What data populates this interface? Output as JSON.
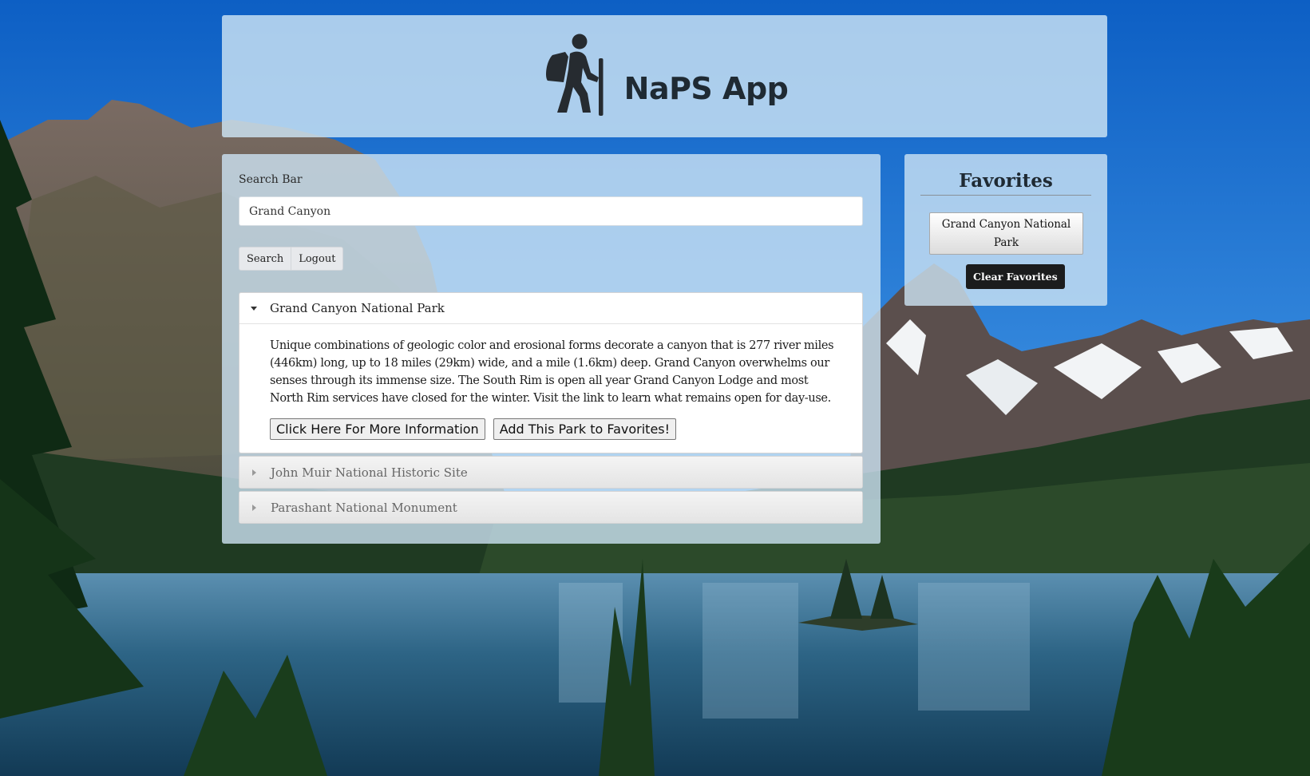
{
  "app": {
    "title": "NaPS App",
    "logo_icon": "hiker-icon"
  },
  "search": {
    "label": "Search Bar",
    "value": "Grand Canyon",
    "search_button": "Search",
    "logout_button": "Logout"
  },
  "results": [
    {
      "title": "Grand Canyon National Park",
      "expanded": true,
      "description": "Unique combinations of geologic color and erosional forms decorate a canyon that is 277 river miles (446km) long, up to 18 miles (29km) wide, and a mile (1.6km) deep. Grand Canyon overwhelms our senses through its immense size. The South Rim is open all year Grand Canyon Lodge and most North Rim services have closed for the winter. Visit the link to learn what remains open for day-use.",
      "more_info_button": "Click Here For More Information",
      "add_favorite_button": "Add This Park to Favorites!"
    },
    {
      "title": "John Muir National Historic Site",
      "expanded": false
    },
    {
      "title": "Parashant National Monument",
      "expanded": false
    }
  ],
  "favorites": {
    "title": "Favorites",
    "items": [
      "Grand Canyon National Park"
    ],
    "clear_button": "Clear Favorites"
  },
  "colors": {
    "panel_bg": "#cde4f4",
    "dark_button": "#1b1c1d",
    "sky": "#1565c0"
  }
}
